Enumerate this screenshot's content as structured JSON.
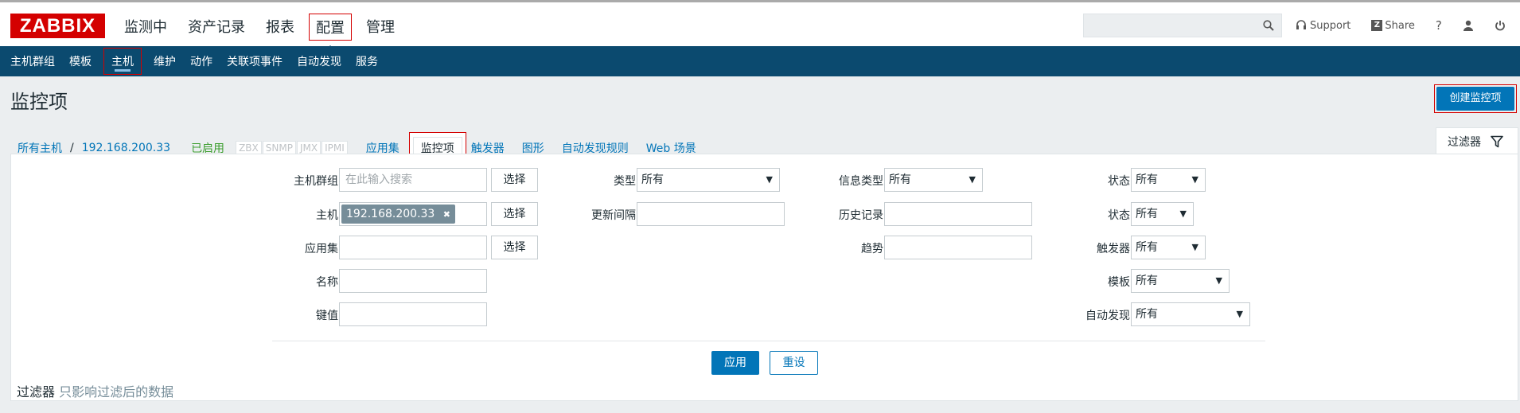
{
  "header": {
    "logo": "ZABBIX",
    "main_nav": [
      "监测中",
      "资产记录",
      "报表",
      "配置",
      "管理"
    ],
    "selected_main": "配置",
    "support": "Support",
    "share": "Share",
    "help": "?"
  },
  "sub_nav": [
    "主机群组",
    "模板",
    "主机",
    "维护",
    "动作",
    "关联项事件",
    "自动发现",
    "服务"
  ],
  "page": {
    "title": "监控项",
    "create_button": "创建监控项"
  },
  "breadcrumb": {
    "all_hosts": "所有主机",
    "separator": "/",
    "host": "192.168.200.33",
    "status": "已启用",
    "tags": [
      "ZBX",
      "SNMP",
      "JMX",
      "IPMI"
    ],
    "links": [
      "应用集",
      "监控项",
      "触发器",
      "图形",
      "自动发现规则",
      "Web 场景"
    ]
  },
  "filter_tab": "过滤器",
  "filter": {
    "host_group_label": "主机群组",
    "host_group_placeholder": "在此输入搜索",
    "select_btn": "选择",
    "host_label": "主机",
    "host_chip": "192.168.200.33",
    "chip_remove": "✖",
    "application_label": "应用集",
    "name_label": "名称",
    "key_label": "键值",
    "type_label": "类型",
    "type_value": "所有",
    "update_interval_label": "更新间隔",
    "info_type_label": "信息类型",
    "info_type_value": "所有",
    "history_label": "历史记录",
    "trends_label": "趋势",
    "state_label": "状态",
    "state_value": "所有",
    "status_label": "状态",
    "status_value": "所有",
    "triggers_label": "触发器",
    "triggers_value": "所有",
    "template_label": "模板",
    "template_value": "所有",
    "discovery_label": "自动发现",
    "discovery_value": "所有",
    "apply_btn": "应用",
    "reset_btn": "重设",
    "note_title": "过滤器",
    "note_text": "只影响过滤后的数据"
  }
}
